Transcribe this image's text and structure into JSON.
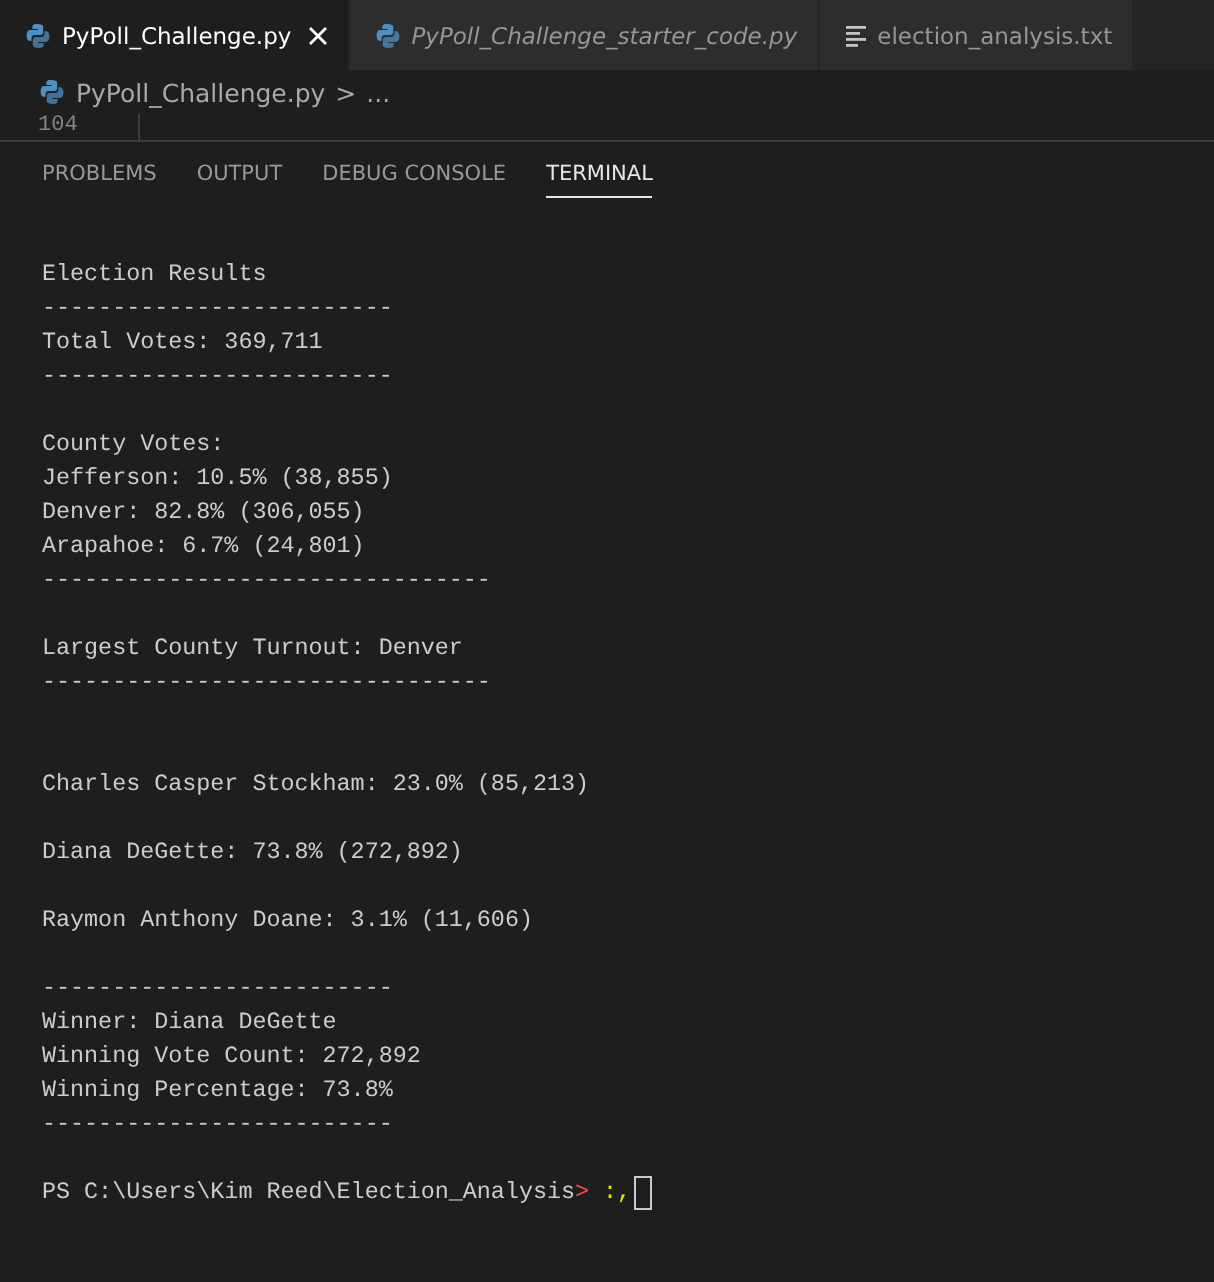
{
  "tabs": [
    {
      "label": "PyPoll_Challenge.py",
      "kind": "python",
      "selected": true,
      "italic": false,
      "closable": true
    },
    {
      "label": "PyPoll_Challenge_starter_code.py",
      "kind": "python",
      "selected": false,
      "italic": true,
      "closable": false
    },
    {
      "label": "election_analysis.txt",
      "kind": "text",
      "selected": false,
      "italic": false,
      "closable": false
    }
  ],
  "breadcrumb": {
    "file": "PyPoll_Challenge.py",
    "separator": ">",
    "rest": "..."
  },
  "editor": {
    "line_number": "104"
  },
  "panel_tabs": [
    {
      "label": "PROBLEMS",
      "selected": false
    },
    {
      "label": "OUTPUT",
      "selected": false
    },
    {
      "label": "DEBUG CONSOLE",
      "selected": false
    },
    {
      "label": "TERMINAL",
      "selected": true
    }
  ],
  "terminal": {
    "lines": [
      {
        "kind": "blank"
      },
      {
        "kind": "text",
        "text": "Election Results"
      },
      {
        "kind": "text",
        "text": "-------------------------"
      },
      {
        "kind": "text",
        "text": "Total Votes: 369,711"
      },
      {
        "kind": "text",
        "text": "-------------------------"
      },
      {
        "kind": "blank"
      },
      {
        "kind": "text",
        "text": "County Votes:"
      },
      {
        "kind": "text",
        "text": "Jefferson: 10.5% (38,855)"
      },
      {
        "kind": "text",
        "text": "Denver: 82.8% (306,055)"
      },
      {
        "kind": "text",
        "text": "Arapahoe: 6.7% (24,801)"
      },
      {
        "kind": "text",
        "text": "--------------------------------"
      },
      {
        "kind": "blank"
      },
      {
        "kind": "text",
        "text": "Largest County Turnout: Denver"
      },
      {
        "kind": "text",
        "text": "--------------------------------"
      },
      {
        "kind": "blank"
      },
      {
        "kind": "blank"
      },
      {
        "kind": "text",
        "text": "Charles Casper Stockham: 23.0% (85,213)"
      },
      {
        "kind": "blank"
      },
      {
        "kind": "text",
        "text": "Diana DeGette: 73.8% (272,892)"
      },
      {
        "kind": "blank"
      },
      {
        "kind": "text",
        "text": "Raymon Anthony Doane: 3.1% (11,606)"
      },
      {
        "kind": "blank"
      },
      {
        "kind": "text",
        "text": "-------------------------"
      },
      {
        "kind": "text",
        "text": "Winner: Diana DeGette"
      },
      {
        "kind": "text",
        "text": "Winning Vote Count: 272,892"
      },
      {
        "kind": "text",
        "text": "Winning Percentage: 73.8%"
      },
      {
        "kind": "text",
        "text": "-------------------------"
      },
      {
        "kind": "blank"
      }
    ],
    "prompt": {
      "path": "PS C:\\Users\\Kim Reed\\Election_Analysis",
      "symbol": ">",
      "input": ":,"
    }
  }
}
